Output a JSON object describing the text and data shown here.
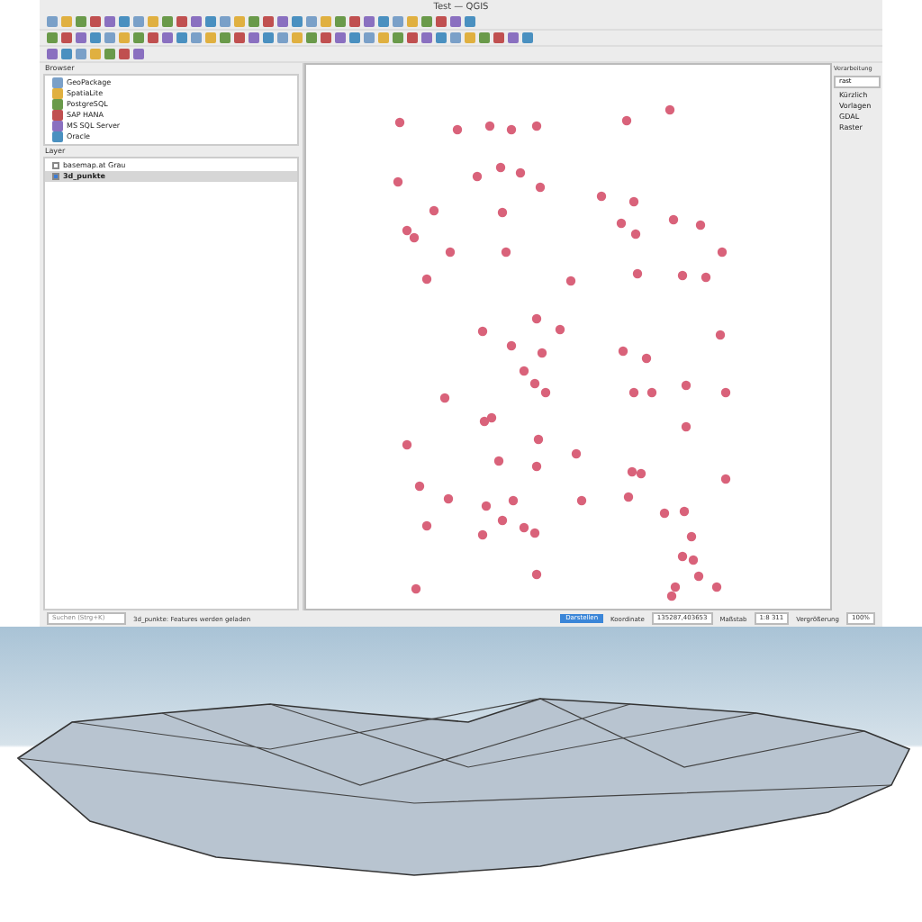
{
  "window": {
    "title": "Test — QGIS"
  },
  "browser": {
    "title": "Browser",
    "items": [
      {
        "label": "GeoPackage"
      },
      {
        "label": "SpatiaLite"
      },
      {
        "label": "PostgreSQL"
      },
      {
        "label": "SAP HANA"
      },
      {
        "label": "MS SQL Server"
      },
      {
        "label": "Oracle"
      }
    ]
  },
  "layers": {
    "title": "Layer",
    "items": [
      {
        "label": "basemap.at Grau",
        "checked": false,
        "selected": false
      },
      {
        "label": "3d_punkte",
        "checked": true,
        "selected": true
      }
    ]
  },
  "processing": {
    "title": "Verarbeitung",
    "search": "rast",
    "items": [
      {
        "label": "Kürzlich"
      },
      {
        "label": "Vorlagen"
      },
      {
        "label": "GDAL"
      },
      {
        "label": "Raster"
      }
    ]
  },
  "status_bar": {
    "search_placeholder": "Suchen (Strg+K)",
    "message": "3d_punkte: Features werden geladen",
    "coordinate_label": "Koordinate",
    "coordinate": "135287,403653",
    "scale_label": "Maßstab",
    "scale": "1:8 311",
    "magnifier_label": "Vergrößerung",
    "magnifier": "100%",
    "render_button": "Darstellen"
  }
}
